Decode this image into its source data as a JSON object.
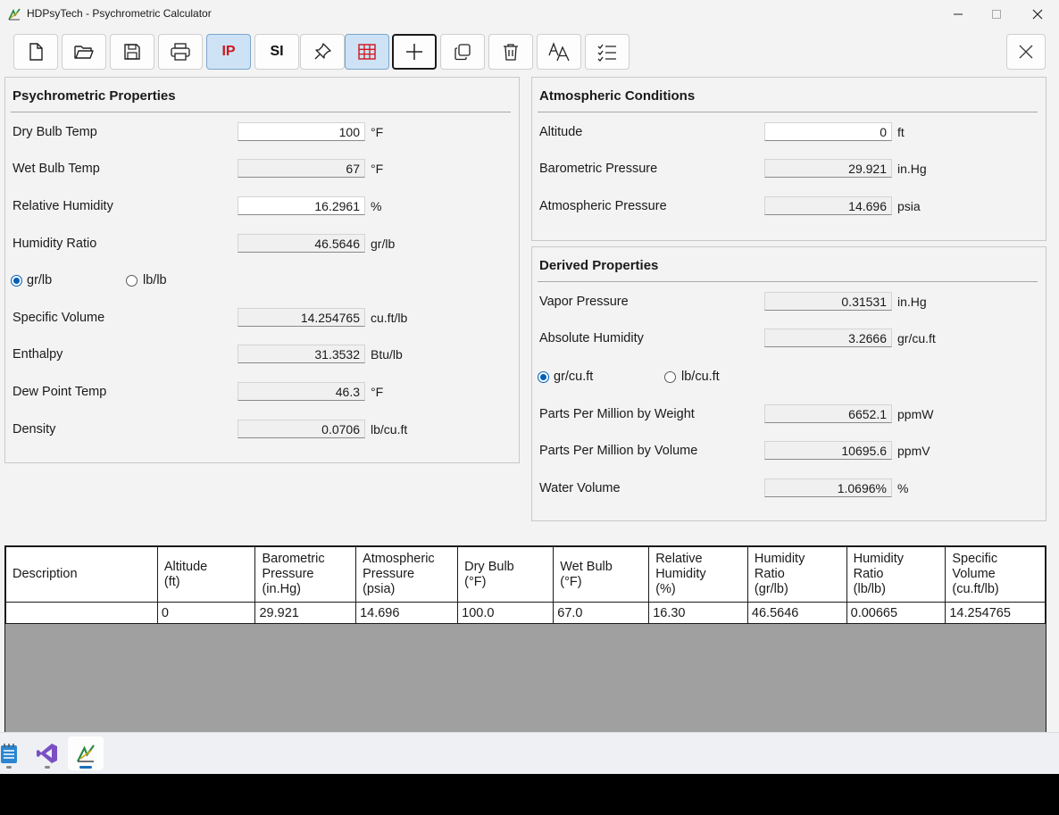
{
  "window": {
    "title": "HDPsyTech - Psychrometric Calculator"
  },
  "toolbar": {
    "ip_label": "IP",
    "si_label": "SI"
  },
  "psychrometric": {
    "title": "Psychrometric Properties",
    "dry_bulb": {
      "label": "Dry Bulb Temp",
      "value": "100",
      "unit": "°F"
    },
    "wet_bulb": {
      "label": "Wet Bulb Temp",
      "value": "67",
      "unit": "°F"
    },
    "relative_humidity": {
      "label": "Relative Humidity",
      "value": "16.2961",
      "unit": "%"
    },
    "humidity_ratio": {
      "label": "Humidity Ratio",
      "value": "46.5646",
      "unit": "gr/lb"
    },
    "radio_grlb": "gr/lb",
    "radio_lblb": "lb/lb",
    "specific_volume": {
      "label": "Specific Volume",
      "value": "14.254765",
      "unit": "cu.ft/lb"
    },
    "enthalpy": {
      "label": "Enthalpy",
      "value": "31.3532",
      "unit": "Btu/lb"
    },
    "dew_point": {
      "label": "Dew Point Temp",
      "value": "46.3",
      "unit": "°F"
    },
    "density": {
      "label": "Density",
      "value": "0.0706",
      "unit": "lb/cu.ft"
    }
  },
  "atmospheric": {
    "title": "Atmospheric Conditions",
    "altitude": {
      "label": "Altitude",
      "value": "0",
      "unit": "ft"
    },
    "barometric": {
      "label": "Barometric Pressure",
      "value": "29.921",
      "unit": "in.Hg"
    },
    "atmospheric_pressure": {
      "label": "Atmospheric Pressure",
      "value": "14.696",
      "unit": "psia"
    }
  },
  "derived": {
    "title": "Derived Properties",
    "vapor_pressure": {
      "label": "Vapor Pressure",
      "value": "0.31531",
      "unit": "in.Hg"
    },
    "absolute_humidity": {
      "label": "Absolute Humidity",
      "value": "3.2666",
      "unit": "gr/cu.ft"
    },
    "radio_grcuft": "gr/cu.ft",
    "radio_lbcuft": "lb/cu.ft",
    "ppm_weight": {
      "label": "Parts Per Million by Weight",
      "value": "6652.1",
      "unit": "ppmW"
    },
    "ppm_volume": {
      "label": "Parts Per Million by Volume",
      "value": "10695.6",
      "unit": "ppmV"
    },
    "water_volume": {
      "label": "Water Volume",
      "value": "1.0696%",
      "unit": "%"
    }
  },
  "grid": {
    "headers": [
      "Description",
      "Altitude\n(ft)",
      "Barometric\nPressure\n(in.Hg)",
      "Atmospheric\nPressure\n(psia)",
      "Dry Bulb\n(°F)",
      "Wet Bulb\n(°F)",
      "Relative\nHumidity\n(%)",
      "Humidity\nRatio\n(gr/lb)",
      "Humidity\nRatio\n(lb/lb)",
      "Specific\nVolume\n(cu.ft/lb)"
    ],
    "row": [
      "",
      "0",
      "29.921",
      "14.696",
      "100.0",
      "67.0",
      "16.30",
      "46.5646",
      "0.00665",
      "14.254765"
    ]
  }
}
